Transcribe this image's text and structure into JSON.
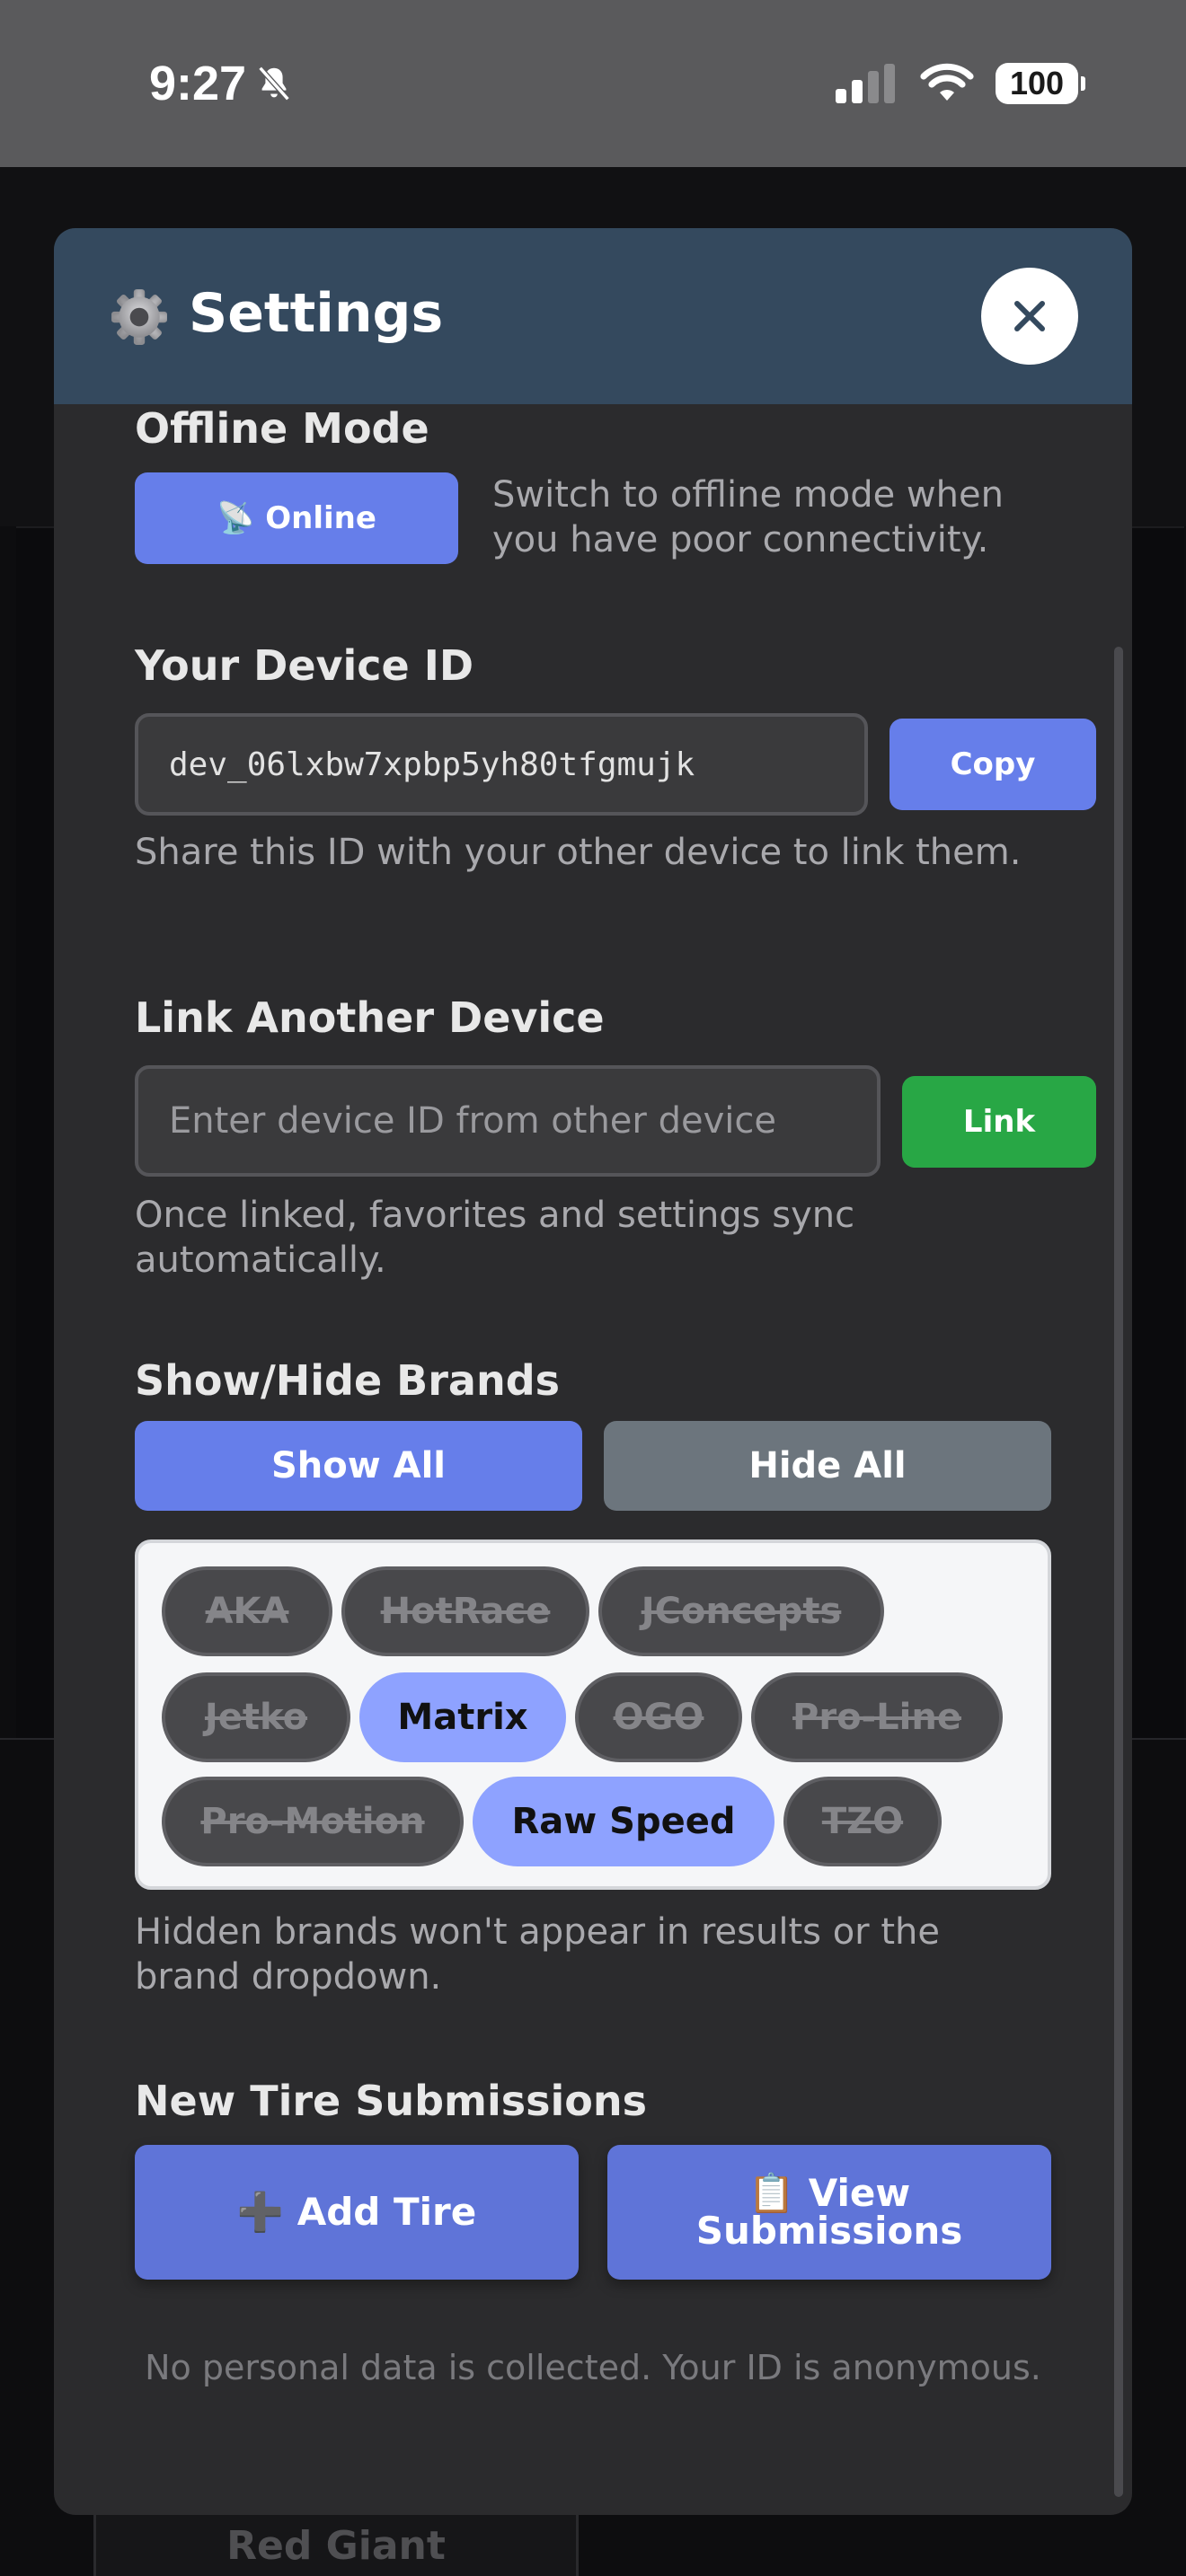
{
  "status_bar": {
    "time": "9:27",
    "battery": "100"
  },
  "background": {
    "card_title": "Red Giant"
  },
  "modal": {
    "title": "Settings",
    "offline": {
      "title": "Offline Mode",
      "button": "📡 Online",
      "help": "Switch to offline mode when you have poor connectivity."
    },
    "device_id": {
      "title": "Your Device ID",
      "value": "dev_06lxbw7xpbp5yh80tfgmujk",
      "copy_label": "Copy",
      "help": "Share this ID with your other device to link them."
    },
    "link_device": {
      "title": "Link Another Device",
      "placeholder": "Enter device ID from other device",
      "value": "",
      "link_label": "Link",
      "help": "Once linked, favorites and settings sync automatically."
    },
    "brands": {
      "title": "Show/Hide Brands",
      "show_all": "Show All",
      "hide_all": "Hide All",
      "items": [
        {
          "name": "AKA",
          "visible": false
        },
        {
          "name": "HotRace",
          "visible": false
        },
        {
          "name": "JConcepts",
          "visible": false
        },
        {
          "name": "Jetko",
          "visible": false
        },
        {
          "name": "Matrix",
          "visible": true
        },
        {
          "name": "OGO",
          "visible": false
        },
        {
          "name": "Pro-Line",
          "visible": false
        },
        {
          "name": "Pro-Motion",
          "visible": false
        },
        {
          "name": "Raw Speed",
          "visible": true
        },
        {
          "name": "TZO",
          "visible": false
        }
      ],
      "help": "Hidden brands won't appear in results or the brand dropdown."
    },
    "submissions": {
      "title": "New Tire Submissions",
      "add_label": "➕ Add Tire",
      "view_label_line1": "📋 View",
      "view_label_line2": "Submissions"
    },
    "footer": "No personal data is collected. Your ID is anonymous."
  },
  "colors": {
    "accent": "#667eea",
    "header": "#34495e",
    "link_green": "#28a745",
    "gray_button": "#6c757d",
    "chip_selected": "#8ea2ff"
  }
}
